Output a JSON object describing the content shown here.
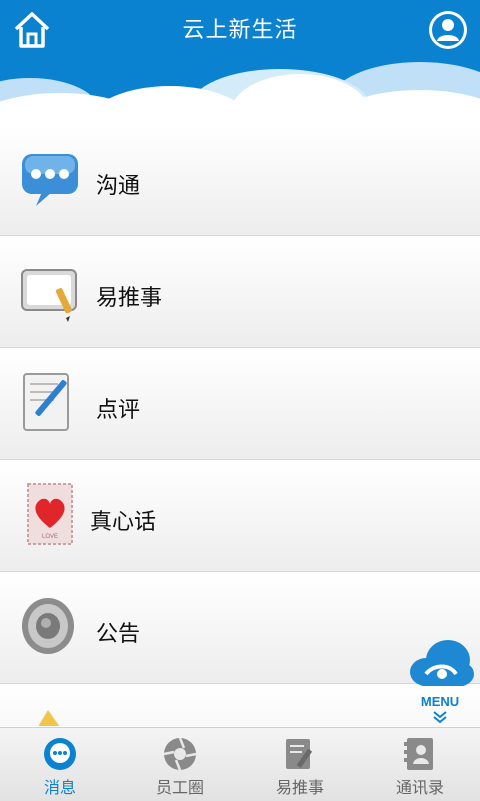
{
  "header": {
    "title": "云上新生活",
    "home_icon": "home-icon",
    "profile_icon": "user-icon"
  },
  "list": {
    "items": [
      {
        "label": "沟通",
        "icon": "chat-bubble-icon"
      },
      {
        "label": "易推事",
        "icon": "notepad-pen-icon"
      },
      {
        "label": "点评",
        "icon": "document-pen-icon"
      },
      {
        "label": "真心话",
        "icon": "heart-stamp-icon"
      },
      {
        "label": "公告",
        "icon": "speaker-icon"
      }
    ]
  },
  "menu": {
    "label": "MENU",
    "icon": "cloud-menu-icon"
  },
  "tabs": [
    {
      "label": "消息",
      "icon": "message-icon",
      "active": true
    },
    {
      "label": "员工圈",
      "icon": "aperture-icon",
      "active": false
    },
    {
      "label": "易推事",
      "icon": "edit-icon",
      "active": false
    },
    {
      "label": "通讯录",
      "icon": "contacts-icon",
      "active": false
    }
  ],
  "colors": {
    "accent": "#0a82cf",
    "tab_inactive": "#666666"
  }
}
